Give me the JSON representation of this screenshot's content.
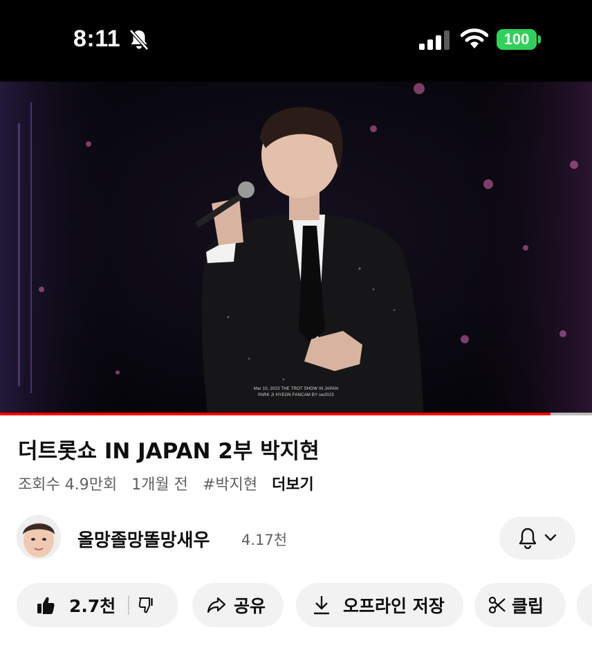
{
  "status_bar": {
    "time": "8:11",
    "battery": "100",
    "icons": [
      "bell-slash-icon",
      "signal-icon",
      "wifi-icon",
      "battery-icon"
    ]
  },
  "video": {
    "caption_line1": "Mar 10, 2023 THE TROT SHOW IN JAPAN",
    "caption_line2": "PARK JI HYEON FANCAM BY sw2023",
    "progress": 0.93
  },
  "info": {
    "title": "더트롯쇼 IN JAPAN 2부 박지현",
    "views": "조회수 4.9만회",
    "time_ago": "1개월 전",
    "hashtag": "#박지현",
    "more": "더보기"
  },
  "channel": {
    "name": "올망졸망똘망새우",
    "subscribers": "4.17천"
  },
  "actions": {
    "likes": "2.7천",
    "share": "공유",
    "download": "오프라인 저장",
    "clip": "클립"
  },
  "colors": {
    "progress_red": "#ff0000",
    "battery_green": "#2fd158",
    "pill_bg": "#f2f2f2"
  }
}
